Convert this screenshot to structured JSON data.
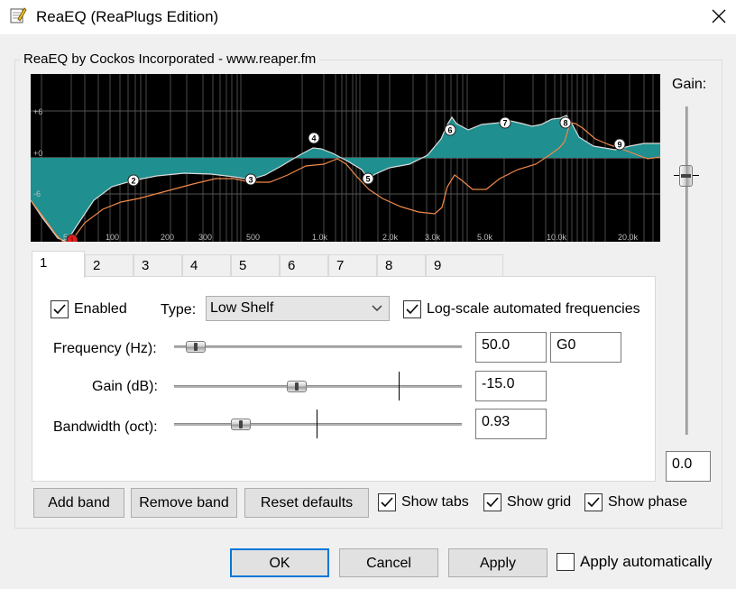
{
  "window": {
    "title": "ReaEQ (ReaPlugs Edition)",
    "icon": "notepad-pencil-icon"
  },
  "group": {
    "title": "ReaEQ by Cockos Incorporated - www.reaper.fm"
  },
  "graph": {
    "db_labels": [
      "+6",
      "+0",
      "-6"
    ],
    "freq_labels": [
      "50",
      "100",
      "200",
      "300",
      "500",
      "1.0k",
      "2.0k",
      "3.0k",
      "5.0k",
      "10.0k",
      "20.0k"
    ],
    "band_nodes": [
      "1",
      "2",
      "3",
      "4",
      "5",
      "6",
      "7",
      "8",
      "9"
    ],
    "selected_band": "1",
    "fill_color": "#1f8f8f",
    "response_line_color": "#dcdcdc",
    "phase_line_color": "#f08a4b",
    "selected_node_color": "#e02020"
  },
  "tabs": [
    "1",
    "2",
    "3",
    "4",
    "5",
    "6",
    "7",
    "8",
    "9"
  ],
  "active_tab": "1",
  "band": {
    "enabled_label": "Enabled",
    "enabled": true,
    "type_label": "Type:",
    "type_value": "Low Shelf",
    "logscale_label": "Log-scale automated frequencies",
    "logscale": true,
    "frequency_label": "Frequency (Hz):",
    "frequency_value": "50.0",
    "frequency_note": "G0",
    "gain_label": "Gain (dB):",
    "gain_value": "-15.0",
    "bandwidth_label": "Bandwidth (oct):",
    "bandwidth_value": "0.93"
  },
  "output_gain": {
    "label": "Gain:",
    "value": "0.0"
  },
  "bottom_bar": {
    "add_band": "Add band",
    "remove_band": "Remove band",
    "reset_defaults": "Reset defaults",
    "show_tabs": "Show tabs",
    "show_tabs_checked": true,
    "show_grid": "Show grid",
    "show_grid_checked": true,
    "show_phase": "Show phase",
    "show_phase_checked": true
  },
  "dialog": {
    "ok": "OK",
    "cancel": "Cancel",
    "apply": "Apply",
    "apply_automatically": "Apply automatically",
    "apply_automatically_checked": false
  }
}
